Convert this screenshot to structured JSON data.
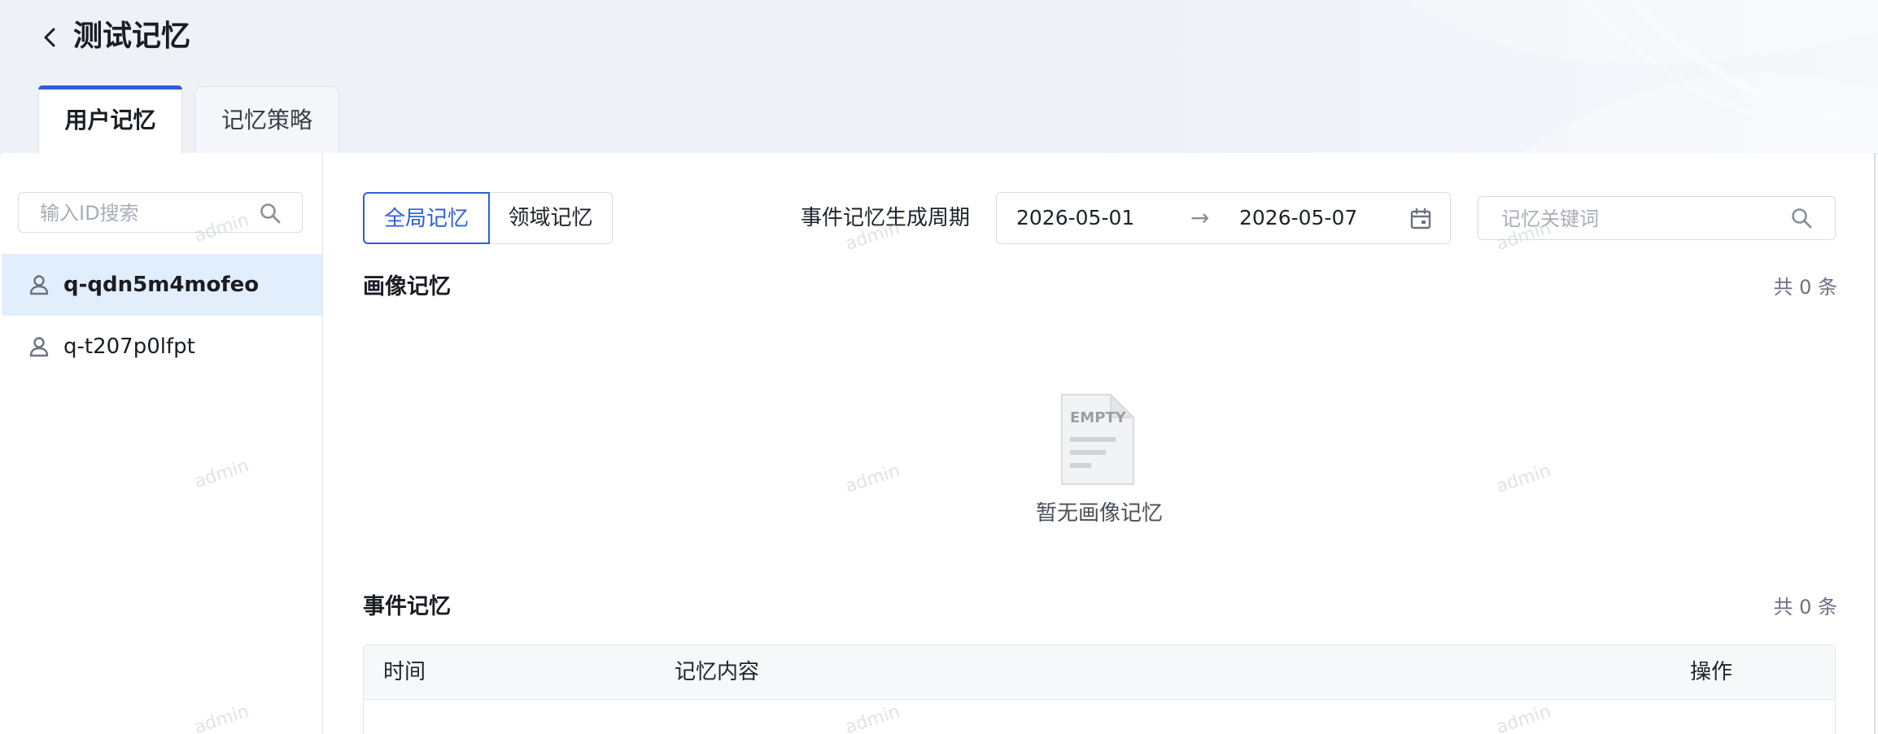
{
  "header": {
    "title": "测试记忆",
    "tabs": [
      {
        "label": "用户记忆",
        "active": true
      },
      {
        "label": "记忆策略",
        "active": false
      }
    ]
  },
  "sidebar": {
    "search_placeholder": "输入ID搜索",
    "users": [
      {
        "id": "q-qdn5m4mofeo",
        "active": true
      },
      {
        "id": "q-t207p0lfpt",
        "active": false
      }
    ]
  },
  "main": {
    "scope_toggle": [
      {
        "label": "全局记忆",
        "active": true
      },
      {
        "label": "领域记忆",
        "active": false
      }
    ],
    "period_label": "事件记忆生成周期",
    "date_start": "2026-05-01",
    "date_arrow": "→",
    "date_end": "2026-05-07",
    "keyword_placeholder": "记忆关键词",
    "profile_section": {
      "title": "画像记忆",
      "count": "共 0 条",
      "empty_text": "暂无画像记忆",
      "empty_icon_text": "EMPTY"
    },
    "event_section": {
      "title": "事件记忆",
      "count": "共 0 条",
      "columns": [
        "时间",
        "记忆内容",
        "操作"
      ]
    }
  },
  "watermark": "admin",
  "colors": {
    "accent": "#2f5ed8",
    "selected_bg": "#e3eefc",
    "border": "#dfe3ea"
  }
}
